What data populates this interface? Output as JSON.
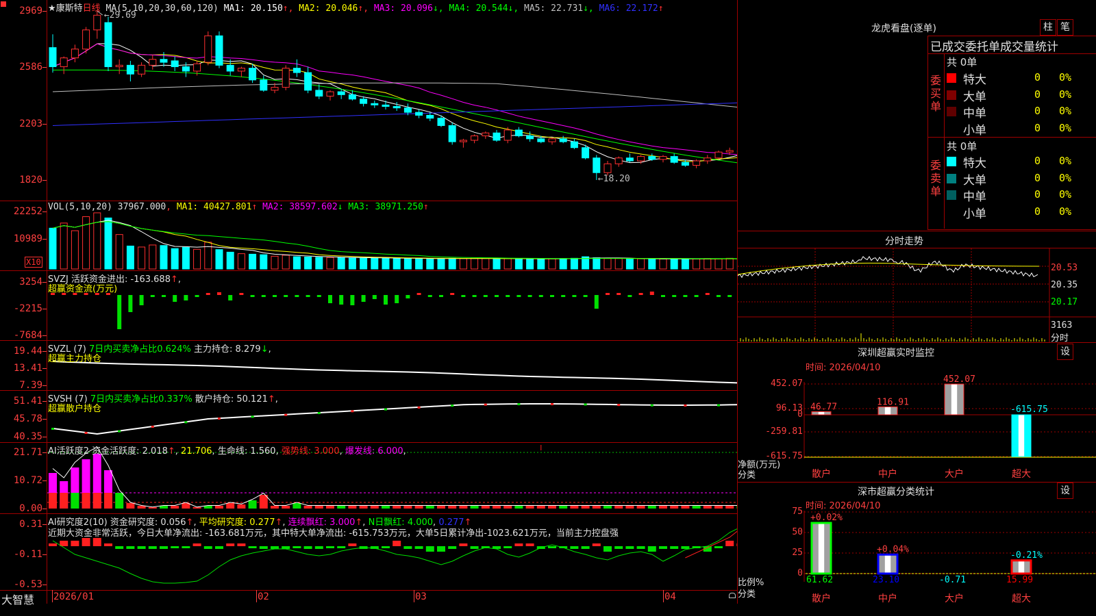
{
  "app": {
    "brand": "大智慧",
    "corner_icon": "square-marker-icon",
    "lock_icon": "lock-icon"
  },
  "kline": {
    "header_stock": "★康斯特",
    "header_period": "日线",
    "header_ma": "MA(5,10,20,30,60,120)",
    "ma": [
      {
        "label": "MA1: 20.150",
        "arrow": "↑",
        "color": "#ffffff"
      },
      {
        "label": "MA2: 20.046",
        "arrow": "↑",
        "color": "#ffff00"
      },
      {
        "label": "MA3: 20.096",
        "arrow": "↓",
        "color": "#ff00ff"
      },
      {
        "label": "MA4: 20.544",
        "arrow": "↓",
        "color": "#00ff00"
      },
      {
        "label": "MA5: 22.731",
        "arrow": "↓",
        "color": "#c0c0c0"
      },
      {
        "label": "MA6: 22.172",
        "arrow": "↑",
        "color": "#3030ff"
      }
    ],
    "y_ticks": [
      "2969",
      "2586",
      "2203",
      "1820"
    ],
    "high_mark": "29.69",
    "low_mark": "18.20"
  },
  "volume": {
    "header": "VOL(5,10,20)",
    "value": "37967.000",
    "ma1": "MA1: 40427.801",
    "ma1_arrow": "↑",
    "ma2": "MA2: 38597.602",
    "ma2_arrow": "↓",
    "ma3": "MA3: 38971.250",
    "ma3_arrow": "↑",
    "y_ticks": [
      "22252",
      "10989"
    ],
    "unit": "X10"
  },
  "svzj": {
    "header": "SVZJ  活跃资金进出: -163.688",
    "arrow": "↑",
    "subtitle": "超赢资金流(万元)",
    "y_ticks": [
      "3254",
      "-2215",
      "-7684"
    ]
  },
  "svzl": {
    "header_a": "SVZL (7)",
    "header_b": "7日内买卖净占比0.624%",
    "header_c": "主力持仓: 8.279",
    "arrow": "↓",
    "subtitle": "超赢主力持仓",
    "y_ticks": [
      "19.44",
      "13.41",
      "7.39"
    ]
  },
  "svsh": {
    "header_a": "SVSH (7)",
    "header_b": "7日内买卖净占比0.337%",
    "header_c": "散户持仓: 50.121",
    "arrow": "↑",
    "subtitle": "超赢散户持仓",
    "y_ticks": [
      "51.41",
      "45.78",
      "40.35"
    ]
  },
  "ai_active": {
    "header": "AI活跃度2 资金活跃度: 2.018",
    "arrow": "↑",
    "v2": "21.706",
    "life": "生命线: 1.560",
    "strong": "强势线: 3.000",
    "burst": "爆发线: 6.000",
    "y_ticks": [
      "21.71",
      "10.72",
      "0.00"
    ]
  },
  "ai_research": {
    "header": "AI研究度2(10) 资金研究度: 0.056",
    "arrow": "↑",
    "avg": "平均研究度: 0.277",
    "avg_arrow": "↑",
    "cont": "连续飘红: 3.000",
    "cont_arrow": "↑",
    "nday": "N日飘红: 4.000",
    "nday2": "0.277",
    "nday2_arrow": "↑",
    "comment": "近期大资金非常活跃，今日大单净流出: -163.681万元，其中特大单净流出: -615.753万元，大单5日累计净出-1023.621万元，当前主力控盘强",
    "y_ticks": [
      "0.31",
      "-0.11",
      "-0.53"
    ]
  },
  "x_axis": {
    "labels": [
      "2026/01",
      "02",
      "03",
      "04"
    ]
  },
  "longhu": {
    "title": "龙虎看盘(逐单)",
    "btn_bar": "柱",
    "btn_pen": "笔",
    "section_title": "已成交委托单成交量统计",
    "buy_label": "委买单",
    "sell_label": "委卖单",
    "buy_total": "共 0单",
    "sell_total": "共 0单",
    "buy_rows": [
      {
        "label": "特大",
        "count": "0",
        "pct": "0%",
        "color": "#ff0000"
      },
      {
        "label": "大单",
        "count": "0",
        "pct": "0%",
        "color": "#800000"
      },
      {
        "label": "中单",
        "count": "0",
        "pct": "0%",
        "color": "#600000"
      },
      {
        "label": "小单",
        "count": "0",
        "pct": "0%",
        "color": "#000000"
      }
    ],
    "sell_rows": [
      {
        "label": "特大",
        "count": "0",
        "pct": "0%",
        "color": "#00ffff"
      },
      {
        "label": "大单",
        "count": "0",
        "pct": "0%",
        "color": "#008080"
      },
      {
        "label": "中单",
        "count": "0",
        "pct": "0%",
        "color": "#006060"
      },
      {
        "label": "小单",
        "count": "0",
        "pct": "0%",
        "color": "#000000"
      }
    ]
  },
  "fenshi": {
    "title": "分时走势",
    "price_ticks": [
      "20.53",
      "20.35",
      "20.17"
    ],
    "vol_tick": "3163",
    "vol_unit": "分时"
  },
  "monitor": {
    "title": "深圳超赢实时监控",
    "btn": "设",
    "time": "时间: 2026/04/10",
    "y_ticks": [
      "452.07",
      "96.13",
      "0",
      "-259.81",
      "-615.75"
    ],
    "y_unit": "净额(万元)",
    "x_unit": "分类",
    "bars": [
      {
        "name": "散户",
        "value": 46.77,
        "label": "46.77"
      },
      {
        "name": "中户",
        "value": 116.91,
        "label": "116.91"
      },
      {
        "name": "大户",
        "value": 452.07,
        "label": "452.07"
      },
      {
        "name": "超大",
        "value": -615.75,
        "label": "-615.75"
      }
    ]
  },
  "classify": {
    "title": "深市超赢分类统计",
    "btn": "设",
    "time": "时间: 2026/04/10",
    "y_ticks": [
      "75",
      "50",
      "25",
      "0"
    ],
    "y_unit": "比例%",
    "x_unit": "分类",
    "bars": [
      {
        "name": "散户",
        "value": 61.62,
        "label": "61.62",
        "change": "+0.02%",
        "color": "#00ff00"
      },
      {
        "name": "中户",
        "value": 23.1,
        "label": "23.10",
        "change": "+0.04%",
        "color": "#0000ff"
      },
      {
        "name": "大户",
        "value": -0.71,
        "label": "-0.71",
        "change": "",
        "color": "#00ffff"
      },
      {
        "name": "超大",
        "value": 15.99,
        "label": "15.99",
        "change": "-0.21%",
        "color": "#ff0000"
      }
    ]
  },
  "chart_data": {
    "type": "candlestick",
    "x_labels": [
      "2026/01",
      "02",
      "03",
      "04"
    ],
    "ohlc": [
      [
        27.2,
        28.1,
        25.5,
        25.9
      ],
      [
        25.9,
        26.6,
        25.4,
        26.5
      ],
      [
        26.5,
        27.4,
        26.2,
        27.1
      ],
      [
        27.1,
        28.6,
        26.8,
        28.4
      ],
      [
        28.4,
        29.69,
        27.8,
        29.4
      ],
      [
        28.9,
        29.3,
        25.6,
        25.9
      ],
      [
        25.9,
        26.4,
        25.4,
        26.0
      ],
      [
        26.0,
        26.3,
        24.9,
        25.4
      ],
      [
        25.4,
        26.2,
        25.2,
        26.0
      ],
      [
        26.0,
        26.7,
        25.7,
        26.4
      ],
      [
        26.4,
        26.9,
        25.9,
        26.2
      ],
      [
        26.3,
        26.6,
        25.6,
        25.9
      ],
      [
        25.9,
        26.2,
        25.2,
        25.6
      ],
      [
        25.6,
        26.3,
        25.3,
        26.1
      ],
      [
        26.2,
        28.3,
        26.0,
        28.0
      ],
      [
        28.0,
        28.3,
        25.8,
        26.0
      ],
      [
        26.0,
        26.4,
        25.3,
        25.6
      ],
      [
        25.6,
        25.9,
        25.2,
        25.8
      ],
      [
        25.8,
        26.1,
        24.8,
        25.0
      ],
      [
        25.0,
        25.3,
        24.2,
        24.3
      ],
      [
        24.3,
        24.8,
        24.1,
        24.5
      ],
      [
        24.5,
        26.0,
        24.3,
        25.8
      ],
      [
        25.8,
        26.4,
        25.2,
        25.5
      ],
      [
        25.5,
        25.9,
        24.1,
        24.3
      ],
      [
        24.3,
        24.7,
        23.7,
        23.9
      ],
      [
        23.9,
        24.3,
        23.6,
        24.2
      ],
      [
        24.2,
        24.4,
        23.7,
        24.0
      ],
      [
        24.0,
        24.3,
        23.6,
        23.7
      ],
      [
        23.7,
        23.9,
        23.2,
        23.4
      ],
      [
        23.4,
        23.6,
        23.1,
        23.3
      ],
      [
        23.3,
        23.6,
        23.0,
        23.2
      ],
      [
        23.2,
        23.5,
        22.9,
        23.1
      ],
      [
        23.1,
        23.4,
        22.6,
        22.8
      ],
      [
        22.8,
        23.0,
        22.4,
        22.6
      ],
      [
        22.6,
        22.8,
        22.2,
        22.4
      ],
      [
        22.4,
        22.6,
        21.8,
        21.9
      ],
      [
        21.9,
        22.1,
        20.6,
        20.8
      ],
      [
        20.8,
        21.0,
        20.4,
        20.9
      ],
      [
        20.9,
        21.3,
        20.7,
        21.2
      ],
      [
        21.2,
        21.5,
        21.0,
        21.4
      ],
      [
        21.4,
        21.6,
        20.8,
        20.9
      ],
      [
        20.9,
        21.8,
        20.7,
        21.6
      ],
      [
        21.6,
        21.8,
        21.1,
        21.2
      ],
      [
        21.2,
        21.5,
        20.8,
        21.0
      ],
      [
        21.0,
        21.2,
        20.7,
        20.8
      ],
      [
        20.8,
        21.1,
        20.6,
        21.0
      ],
      [
        21.0,
        21.2,
        20.7,
        20.8
      ],
      [
        20.8,
        21.0,
        20.3,
        20.4
      ],
      [
        20.4,
        20.6,
        19.6,
        19.7
      ],
      [
        19.7,
        19.9,
        18.2,
        18.7
      ],
      [
        18.7,
        19.5,
        18.5,
        19.3
      ],
      [
        19.3,
        19.8,
        19.1,
        19.7
      ],
      [
        19.7,
        20.0,
        19.4,
        19.5
      ],
      [
        19.5,
        19.9,
        19.3,
        19.8
      ],
      [
        19.8,
        20.0,
        19.5,
        19.6
      ],
      [
        19.6,
        19.9,
        19.4,
        19.8
      ],
      [
        19.8,
        20.0,
        19.3,
        19.4
      ],
      [
        19.4,
        19.6,
        19.1,
        19.2
      ],
      [
        19.2,
        19.6,
        19.0,
        19.5
      ],
      [
        19.5,
        19.9,
        19.3,
        19.7
      ],
      [
        19.7,
        20.2,
        19.6,
        20.1
      ],
      [
        20.1,
        20.4,
        19.9,
        20.2
      ],
      [
        20.2,
        20.4,
        20.0,
        20.1
      ]
    ],
    "volume": [
      1600,
      1800,
      1500,
      2050,
      2200,
      2000,
      1350,
      900,
      860,
      940,
      920,
      800,
      850,
      770,
      1050,
      760,
      660,
      600,
      580,
      560,
      500,
      540,
      480,
      470,
      460,
      450,
      450,
      440,
      430,
      430,
      420,
      420,
      410,
      410,
      400,
      400,
      420,
      410,
      420,
      410,
      400,
      410,
      400,
      400,
      390,
      400,
      410,
      420,
      480,
      440,
      410,
      410,
      390,
      400,
      400,
      390,
      400,
      390,
      400,
      410,
      400,
      420,
      380
    ],
    "y_range": [
      18.2,
      29.69
    ]
  }
}
